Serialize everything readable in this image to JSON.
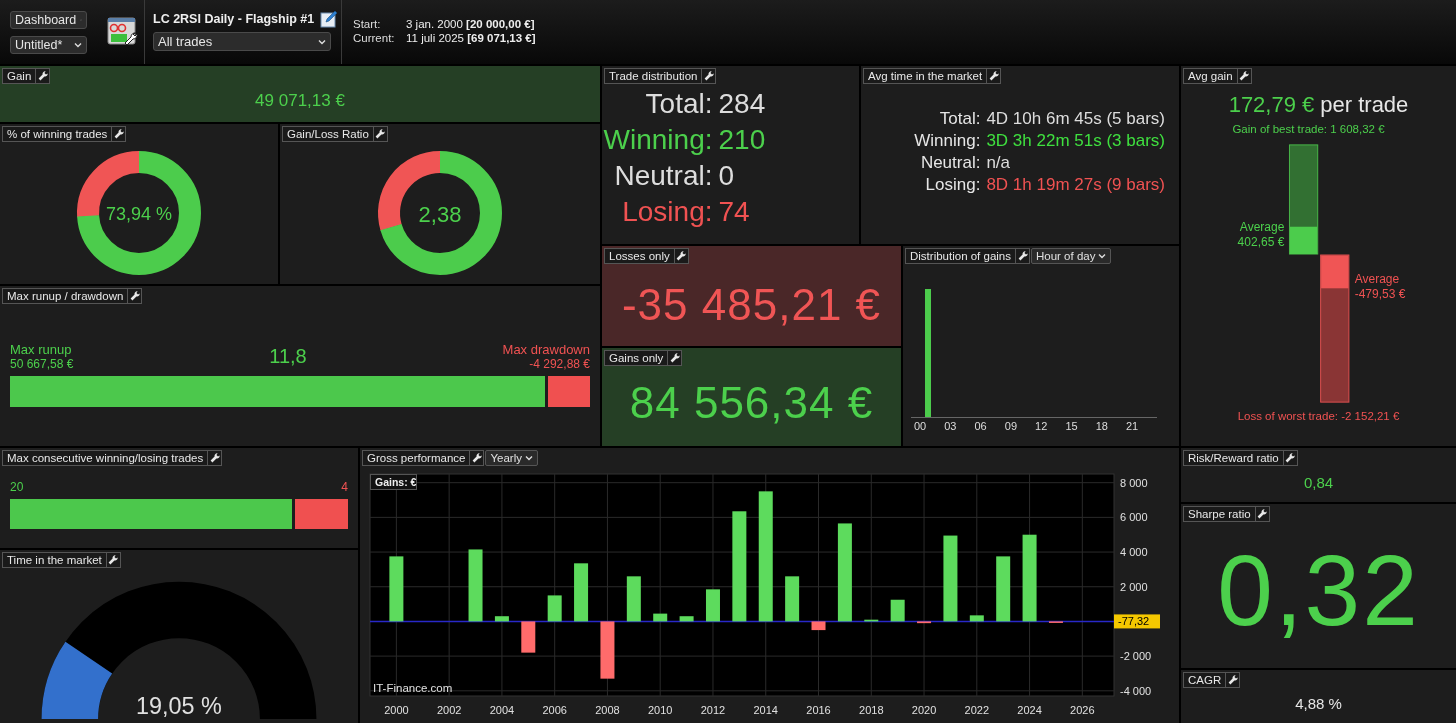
{
  "header": {
    "view_select": "Dashboard",
    "layout_select": "Untitled*",
    "strategy_title": "LC 2RSI Daily - Flagship #1",
    "trades_filter": "All trades",
    "dates": [
      {
        "label": "Start:",
        "value": "3 jan. 2000 **[20 000,00 €]**"
      },
      {
        "label": "Current:",
        "value": "11 juli 2025 **[69 071,13 €]**"
      }
    ]
  },
  "gain": {
    "title": "Gain",
    "value": "49 071,13 €"
  },
  "winning_pct": {
    "title": "% of winning trades",
    "value": "73,94 %",
    "level": 0.7394
  },
  "gain_loss_ratio": {
    "title": "Gain/Loss Ratio",
    "value": "2,38",
    "level": 0.704
  },
  "trade_distribution": {
    "title": "Trade distribution",
    "rows": [
      {
        "kind": "total",
        "label": "Total:",
        "value": "284"
      },
      {
        "kind": "winning",
        "label": "Winning:",
        "value": "210"
      },
      {
        "kind": "neutral",
        "label": "Neutral:",
        "value": "0"
      },
      {
        "kind": "losing",
        "label": "Losing:",
        "value": "74"
      }
    ]
  },
  "avg_time": {
    "title": "Avg time in the market",
    "rows": [
      {
        "kind": "total",
        "label": "Total:",
        "value": "4D 10h 6m 45s (5 bars)"
      },
      {
        "kind": "winning",
        "label": "Winning:",
        "value": "3D 3h 22m 51s (3 bars)"
      },
      {
        "kind": "neutral",
        "label": "Neutral:",
        "value": "n/a"
      },
      {
        "kind": "losing",
        "label": "Losing:",
        "value": "8D 1h 19m 27s (9 bars)"
      }
    ]
  },
  "avg_gain": {
    "title": "Avg gain",
    "value": "172,79 €",
    "suffix": "per trade",
    "best_label": "Gain of best trade: 1 608,32 €",
    "worst_label": "Loss of worst trade: -2 152,21 €",
    "gain_average": {
      "label": "Average",
      "value": "402,65 €",
      "level": 0.25
    },
    "loss_average": {
      "label": "Average",
      "value": "-479,53 €",
      "level": 0.223
    }
  },
  "runup": {
    "title": "Max runup / drawdown",
    "runup_label": "Max runup",
    "runup_value": "50 667,58 €",
    "ratio": "11,8",
    "drawdown_label": "Max drawdown",
    "drawdown_value": "-4 292,88 €",
    "level": 0.922
  },
  "losses_only": {
    "title": "Losses only",
    "value": "-35 485,21 €"
  },
  "gains_only": {
    "title": "Gains only",
    "value": "84 556,34 €"
  },
  "distribution": {
    "title": "Distribution of gains",
    "mode": "Hour of day",
    "x_labels": [
      "00",
      "03",
      "06",
      "09",
      "12",
      "15",
      "18",
      "21"
    ]
  },
  "max_consecutive": {
    "title": "Max consecutive winning/losing trades",
    "winning": "20",
    "losing": "4",
    "level": 0.833
  },
  "time_in_market": {
    "title": "Time in the market",
    "value": "19,05 %",
    "level": 0.1905
  },
  "gross": {
    "title": "Gross performance",
    "period": "Yearly",
    "watermark": "IT-Finance.com",
    "chart_data": {
      "type": "bar",
      "title": "Gains: €",
      "x": [
        2000,
        2003,
        2004,
        2005,
        2006,
        2007,
        2008,
        2009,
        2010,
        2011,
        2012,
        2013,
        2014,
        2015,
        2016,
        2017,
        2018,
        2019,
        2020,
        2021,
        2022,
        2023,
        2024,
        2025
      ],
      "xlim": [
        1999,
        2027.2
      ],
      "ylim": [
        -4300,
        8500
      ],
      "grid": true,
      "values": [
        3750,
        4150,
        300,
        -1800,
        1500,
        3350,
        -3300,
        2600,
        450,
        300,
        1850,
        6350,
        7500,
        2600,
        -500,
        5650,
        100,
        1250,
        -100,
        4950,
        350,
        3750,
        5000,
        -80
      ],
      "ref_lines": [
        {
          "axis": "y",
          "value": 0,
          "color": "#2828c8"
        }
      ],
      "xticks": [
        2000,
        2002,
        2004,
        2006,
        2008,
        2010,
        2012,
        2014,
        2016,
        2018,
        2020,
        2022,
        2024,
        2026
      ],
      "yticks": [
        {
          "value": -4000,
          "label": "-4 000"
        },
        {
          "value": -2000,
          "label": "-2 000"
        },
        {
          "value": 2000,
          "label": "2 000"
        },
        {
          "value": 4000,
          "label": "4 000"
        },
        {
          "value": 6000,
          "label": "6 000"
        },
        {
          "value": 8000,
          "label": "8 000"
        }
      ],
      "annotations": [
        "-77,32"
      ]
    }
  },
  "risk_reward": {
    "title": "Risk/Reward ratio",
    "value": "0,84"
  },
  "sharpe": {
    "title": "Sharpe ratio",
    "value": "0,32"
  },
  "cagr": {
    "title": "CAGR",
    "value": "4,88 %"
  }
}
